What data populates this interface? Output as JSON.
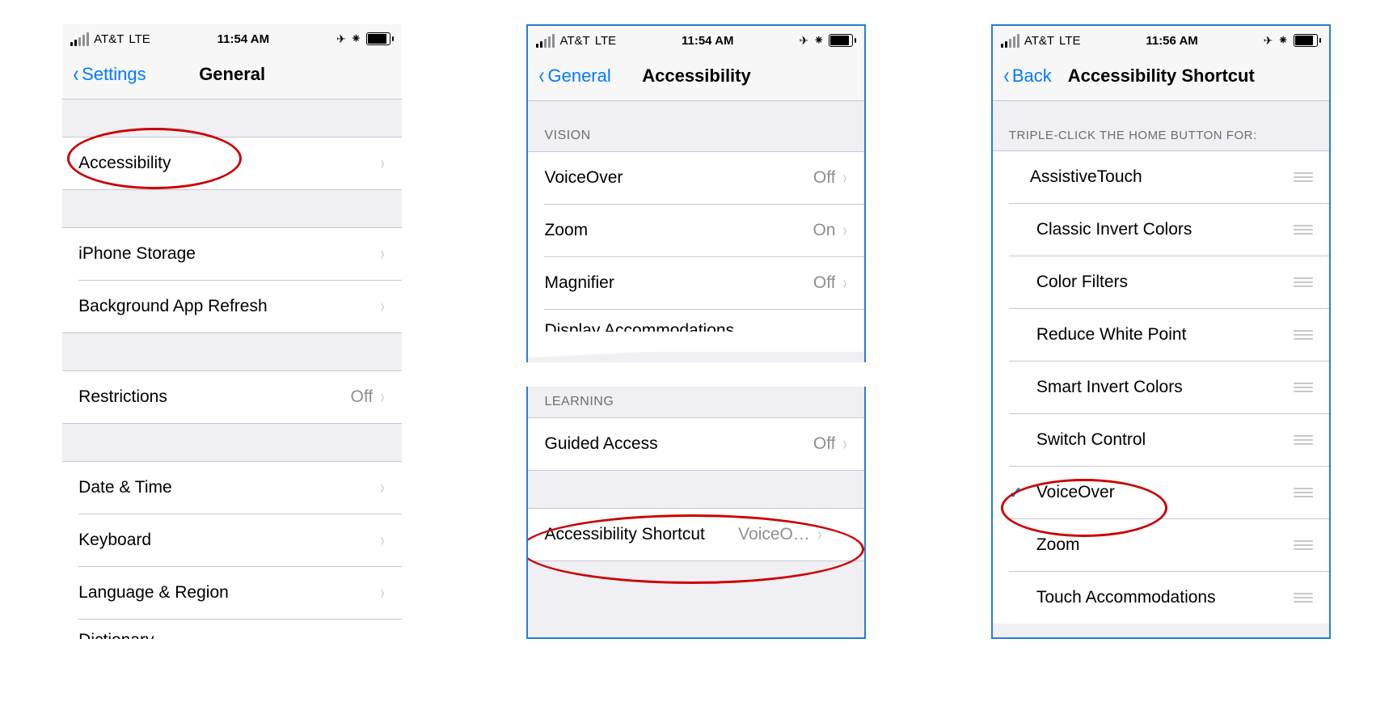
{
  "status": {
    "carrier": "AT&T",
    "network": "LTE",
    "time1": "11:54 AM",
    "time2": "11:54 AM",
    "time3": "11:56 AM",
    "loc_glyph": "➤",
    "bt_glyph": "✱"
  },
  "screen1": {
    "back": "Settings",
    "title": "General",
    "rows": {
      "accessibility": "Accessibility",
      "iphone_storage": "iPhone Storage",
      "background_refresh": "Background App Refresh",
      "restrictions": "Restrictions",
      "restrictions_val": "Off",
      "date_time": "Date & Time",
      "keyboard": "Keyboard",
      "language_region": "Language & Region",
      "dictionary": "Dictionary"
    }
  },
  "screen2": {
    "back": "General",
    "title": "Accessibility",
    "vision_header": "VISION",
    "voiceover": "VoiceOver",
    "voiceover_val": "Off",
    "zoom": "Zoom",
    "zoom_val": "On",
    "magnifier": "Magnifier",
    "magnifier_val": "Off",
    "display_accom": "Display Accommodations",
    "learning_header": "LEARNING",
    "guided": "Guided Access",
    "guided_val": "Off",
    "shortcut": "Accessibility Shortcut",
    "shortcut_val": "VoiceO…"
  },
  "screen3": {
    "back": "Back",
    "title": "Accessibility Shortcut",
    "header": "TRIPLE-CLICK THE HOME BUTTON FOR:",
    "items": [
      {
        "label": "AssistiveTouch",
        "checked": false
      },
      {
        "label": "Classic Invert Colors",
        "checked": false
      },
      {
        "label": "Color Filters",
        "checked": false
      },
      {
        "label": "Reduce White Point",
        "checked": false
      },
      {
        "label": "Smart Invert Colors",
        "checked": false
      },
      {
        "label": "Switch Control",
        "checked": false
      },
      {
        "label": "VoiceOver",
        "checked": true
      },
      {
        "label": "Zoom",
        "checked": false
      },
      {
        "label": "Touch Accommodations",
        "checked": false
      }
    ]
  }
}
